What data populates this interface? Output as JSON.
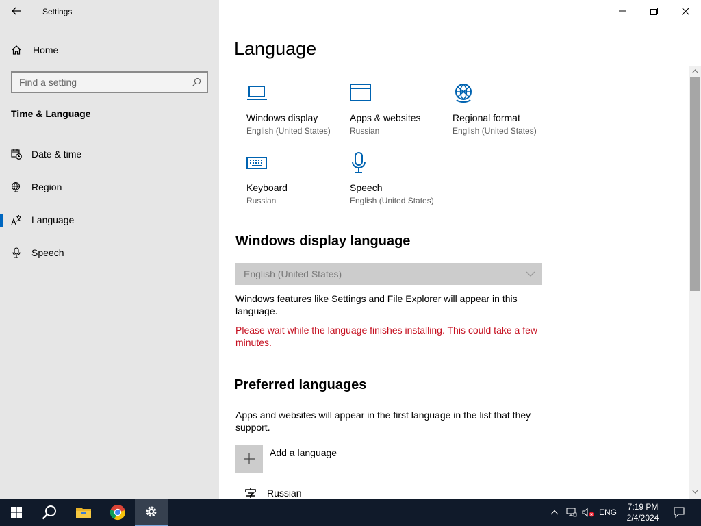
{
  "window": {
    "title": "Settings"
  },
  "sidebar": {
    "home_label": "Home",
    "search_placeholder": "Find a setting",
    "section_title": "Time & Language",
    "items": [
      {
        "label": "Date & time",
        "icon": "calendar-clock-icon"
      },
      {
        "label": "Region",
        "icon": "globe-icon"
      },
      {
        "label": "Language",
        "icon": "language-icon",
        "selected": true
      },
      {
        "label": "Speech",
        "icon": "microphone-icon"
      }
    ]
  },
  "main": {
    "title": "Language",
    "tiles": [
      {
        "name": "Windows display",
        "sub": "English (United States)",
        "icon": "monitor-icon"
      },
      {
        "name": "Apps & websites",
        "sub": "Russian",
        "icon": "window-icon"
      },
      {
        "name": "Regional format",
        "sub": "English (United States)",
        "icon": "globe-icon"
      },
      {
        "name": "Keyboard",
        "sub": "Russian",
        "icon": "keyboard-icon"
      },
      {
        "name": "Speech",
        "sub": "English (United States)",
        "icon": "microphone-icon"
      }
    ],
    "display_language": {
      "heading": "Windows display language",
      "selected": "English (United States)",
      "description": "Windows features like Settings and File Explorer will appear in this language.",
      "warning": "Please wait while the language finishes installing. This could take a few minutes."
    },
    "preferred": {
      "heading": "Preferred languages",
      "description": "Apps and websites will appear in the first language in the list that they support.",
      "add_label": "Add a language",
      "languages": [
        {
          "name": "Russian"
        }
      ]
    }
  },
  "taskbar": {
    "tray": {
      "input_lang": "ENG",
      "time": "7:19 PM",
      "date": "2/4/2024"
    }
  },
  "colors": {
    "accent": "#0067c0",
    "warning": "#c50f1f",
    "icon_blue": "#0063b1",
    "taskbar": "#101a2a"
  }
}
